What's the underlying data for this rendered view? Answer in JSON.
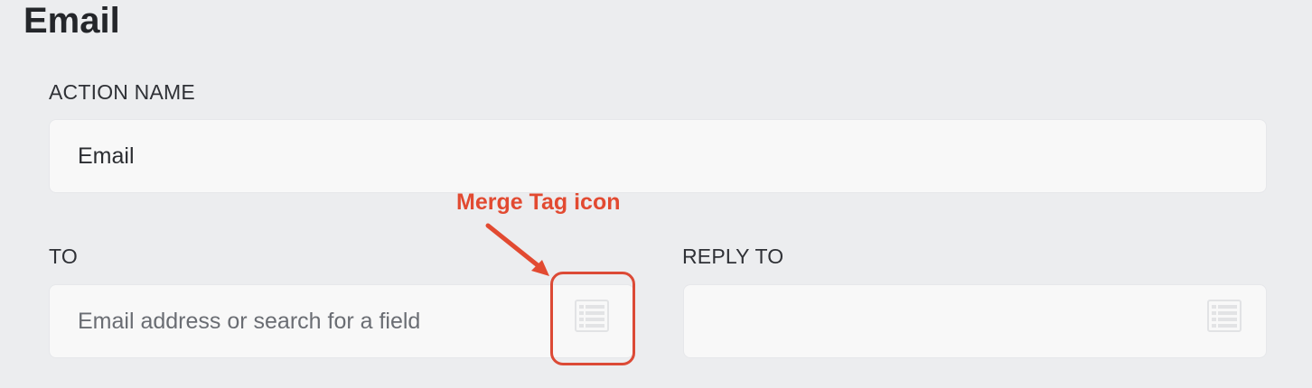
{
  "section": {
    "title": "Email"
  },
  "fields": {
    "action_name": {
      "label": "ACTION NAME",
      "value": "Email"
    },
    "to": {
      "label": "TO",
      "placeholder": "Email address or search for a field",
      "icon": "merge-tag-icon"
    },
    "reply_to": {
      "label": "REPLY TO",
      "value": "",
      "icon": "merge-tag-icon"
    }
  },
  "annotation": {
    "text": "Merge Tag icon",
    "color": "#e24a31"
  },
  "colors": {
    "background": "#ecedef",
    "input_background": "#f8f8f8",
    "icon": "#e2e3e5"
  }
}
